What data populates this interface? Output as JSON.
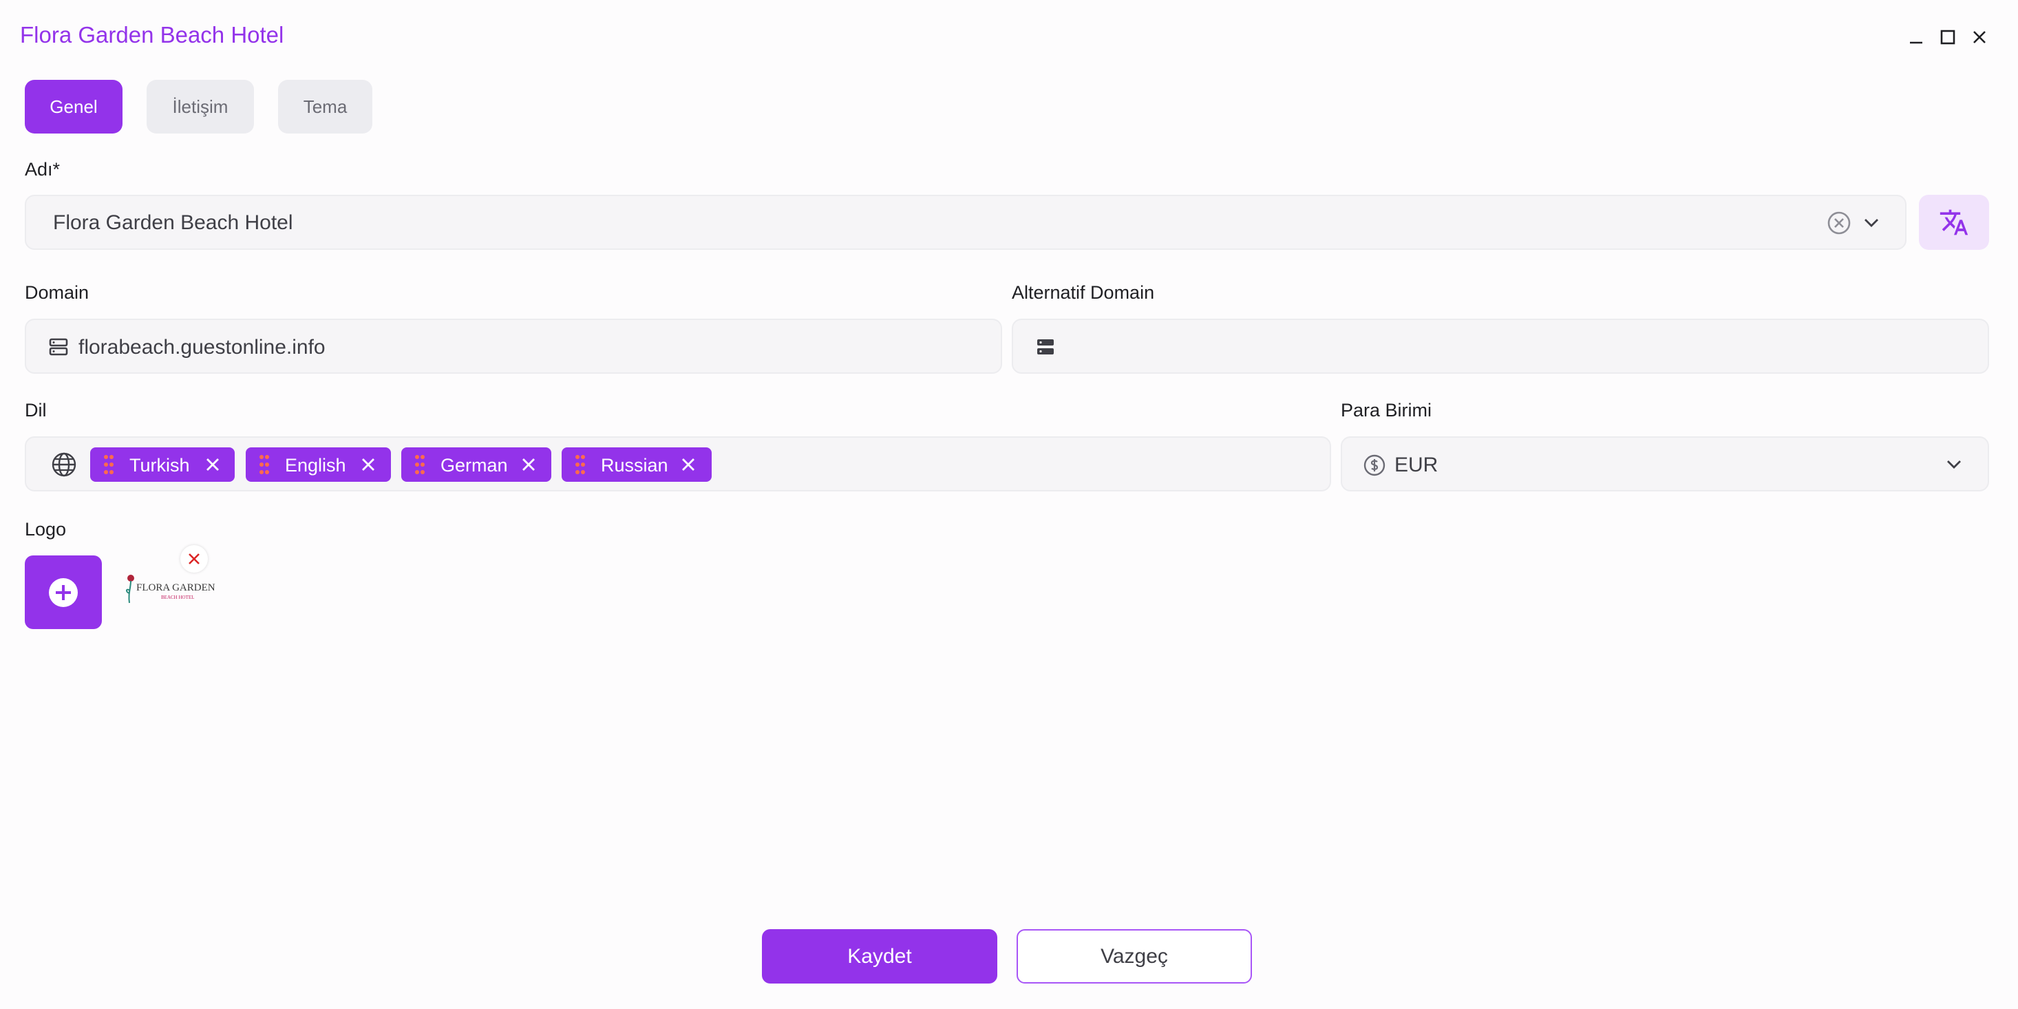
{
  "window": {
    "title": "Flora Garden Beach Hotel",
    "controls": [
      "minimize-icon",
      "maximize-icon",
      "close-icon"
    ]
  },
  "tabs": [
    {
      "label": "Genel",
      "active": true
    },
    {
      "label": "İletişim",
      "active": false
    },
    {
      "label": "Tema",
      "active": false
    }
  ],
  "form": {
    "name": {
      "label": "Adı*",
      "value": "Flora Garden Beach Hotel"
    },
    "domain": {
      "label": "Domain",
      "value": "florabeach.guestonline.info"
    },
    "alt_domain": {
      "label": "Alternatif Domain",
      "value": ""
    },
    "language": {
      "label": "Dil",
      "chips": [
        "Turkish",
        "English",
        "German",
        "Russian"
      ]
    },
    "currency": {
      "label": "Para Birimi",
      "value": "EUR"
    },
    "logo": {
      "label": "Logo",
      "image_text_main": "FLORA GARDEN",
      "image_text_sub": "BEACH HOTEL"
    }
  },
  "actions": {
    "save_label": "Kaydet",
    "cancel_label": "Vazgeç"
  },
  "colors": {
    "accent": "#9333ea",
    "chip_grip": "#ff6a4d",
    "remove_red": "#dc2626",
    "translate_bg": "#f1e3fc"
  }
}
